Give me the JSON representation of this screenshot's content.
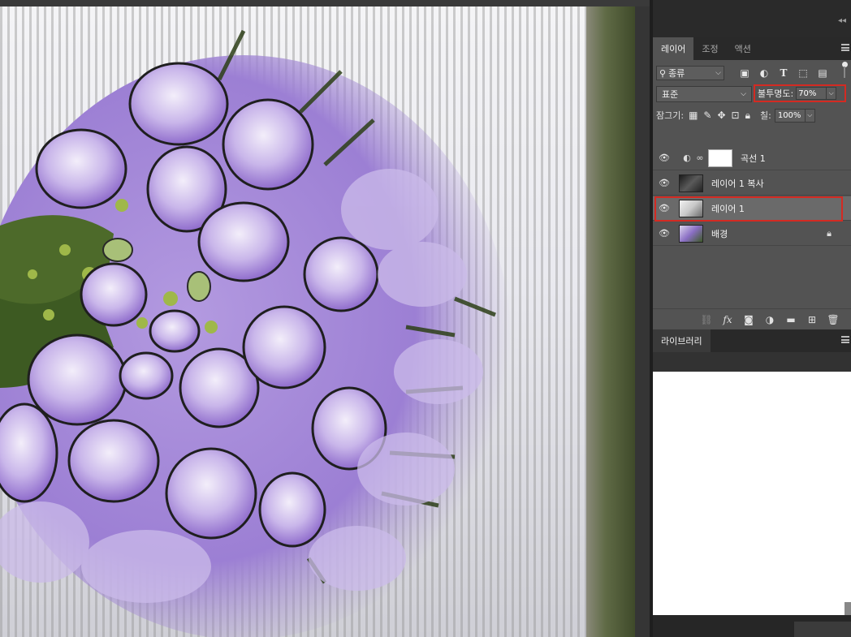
{
  "panels": {
    "layers_tabs": [
      "레이어",
      "조정",
      "액션"
    ],
    "filter_kind": "종류",
    "filter_icons": [
      "image-filter-icon",
      "adjustment-filter-icon",
      "type-filter-icon",
      "shape-filter-icon",
      "smart-object-filter-icon"
    ],
    "blend_mode": "표준",
    "opacity_label": "불투명도:",
    "opacity_value": "70%",
    "lock_label": "잠그기:",
    "lock_icons": [
      "lock-transparent-icon",
      "lock-paint-icon",
      "lock-position-icon",
      "lock-artboard-icon",
      "lock-all-icon"
    ],
    "fill_label": "칠:",
    "fill_value": "100%",
    "layers": [
      {
        "name": "곡선 1",
        "type": "adjustment",
        "visible": true
      },
      {
        "name": "레이어 1 복사",
        "type": "pixel",
        "visible": true
      },
      {
        "name": "레이어 1",
        "type": "pixel",
        "visible": true,
        "selected": true
      },
      {
        "name": "배경",
        "type": "background",
        "visible": true,
        "locked": true
      }
    ],
    "footer_icons": [
      "link-layers-icon",
      "fx-icon",
      "add-mask-icon",
      "new-adjustment-icon",
      "new-group-icon",
      "new-layer-icon",
      "trash-icon"
    ],
    "library_tab": "라이브러리"
  },
  "colors": {
    "highlight": "#d42a22",
    "panel_bg": "#535353",
    "selected_layer": "#6a6a6a"
  }
}
